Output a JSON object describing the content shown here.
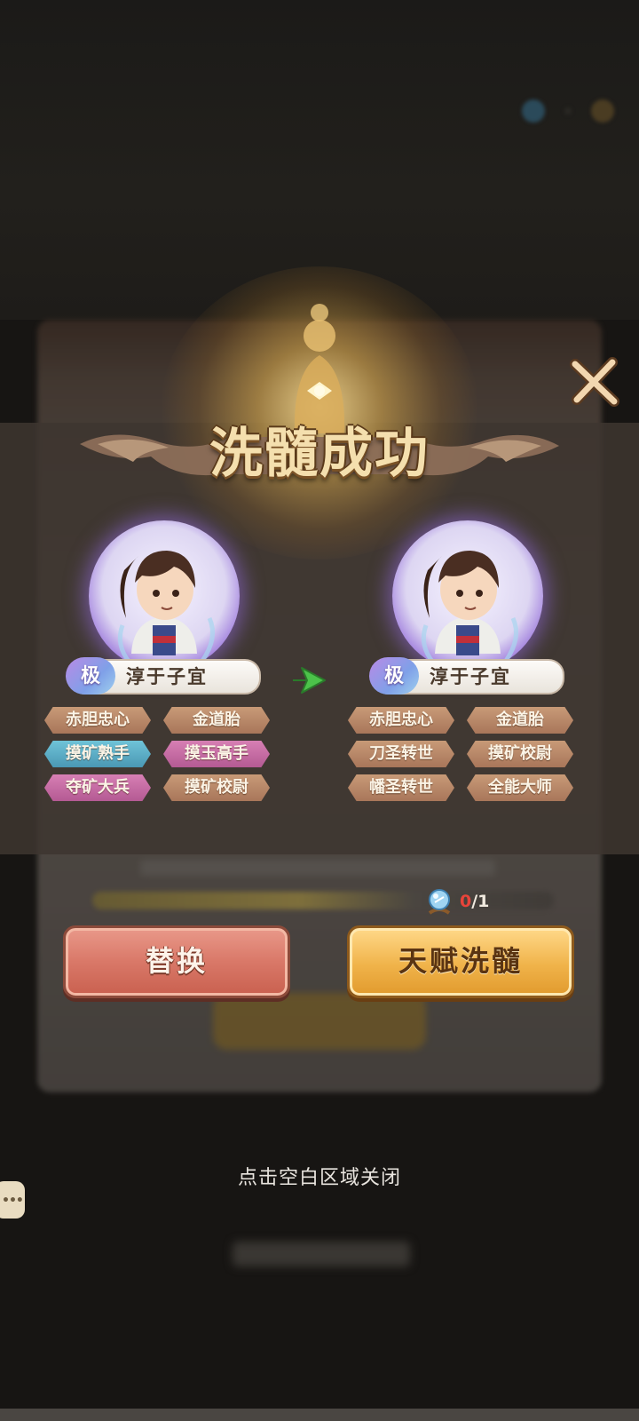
{
  "dialog": {
    "title": "洗髓成功",
    "close_icon": "close-x-icon"
  },
  "before": {
    "grade": "极",
    "name": "淳于子宜",
    "talents": [
      {
        "label": "赤胆忠心",
        "color": "brown"
      },
      {
        "label": "金道胎",
        "color": "brown"
      },
      {
        "label": "摸矿熟手",
        "color": "blue"
      },
      {
        "label": "摸玉高手",
        "color": "pink"
      },
      {
        "label": "夺矿大兵",
        "color": "pink"
      },
      {
        "label": "摸矿校尉",
        "color": "brown"
      }
    ]
  },
  "after": {
    "grade": "极",
    "name": "淳于子宜",
    "talents": [
      {
        "label": "赤胆忠心",
        "color": "brown"
      },
      {
        "label": "金道胎",
        "color": "brown"
      },
      {
        "label": "刀圣转世",
        "color": "brown"
      },
      {
        "label": "摸矿校尉",
        "color": "brown"
      },
      {
        "label": "幡圣转世",
        "color": "brown"
      },
      {
        "label": "全能大师",
        "color": "brown"
      }
    ]
  },
  "cost": {
    "icon": "crystal-orb-icon",
    "have": "0",
    "need": "/1"
  },
  "buttons": {
    "replace_label": "替换",
    "reroll_label": "天赋洗髓"
  },
  "hint": "点击空白区域关闭",
  "colors": {
    "talent_brown": "#b8866a",
    "talent_blue": "#5aaec6",
    "talent_pink": "#c66da4",
    "replace_button": "#d97868",
    "reroll_button": "#f0b34a",
    "cost_red": "#e8443a"
  }
}
